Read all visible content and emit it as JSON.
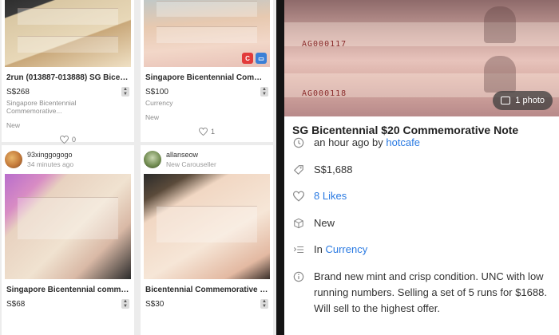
{
  "listings": [
    {
      "seller_name": "",
      "seller_time": "",
      "title": "2run (013887-013888) SG Bicen...",
      "price": "S$268",
      "category": "Singapore Bicentennial Commemorative...",
      "condition": "New",
      "likes": "0"
    },
    {
      "seller_name": "",
      "seller_time": "",
      "title": "Singapore Bicentennial Comme...",
      "price": "S$100",
      "category": "Currency",
      "condition": "New",
      "likes": "1"
    },
    {
      "seller_name": "93xinggogogo",
      "seller_time": "34 minutes ago",
      "title": "Singapore Bicentennial comme...",
      "price": "S$68",
      "category": "",
      "condition": "",
      "likes": ""
    },
    {
      "seller_name": "allanseow",
      "seller_time": "New Carouseller",
      "title": "Bicentennial Commemorative N...",
      "price": "S$30",
      "category": "",
      "condition": "",
      "likes": ""
    }
  ],
  "detail": {
    "photo_count": "1 photo",
    "title": "SG Bicentennial $20 Commemorative Note",
    "posted_prefix": "an hour ago by ",
    "seller": "hotcafe",
    "price": "S$1,688",
    "likes": "8 Likes",
    "condition": "New",
    "category_prefix": "In ",
    "category": "Currency",
    "description": "Brand new mint and crisp condition. UNC with low running numbers. Selling a set of  5 runs for $1688. Will sell to the highest offer."
  },
  "colors": {
    "link": "#2a7ae2",
    "badge_red": "#e23b3b",
    "badge_blue": "#3b7fd6"
  },
  "icons": {
    "clock": "clock-icon",
    "tag": "price-tag-icon",
    "heart": "heart-icon",
    "box": "condition-box-icon",
    "category": "category-list-icon",
    "info": "info-icon"
  }
}
